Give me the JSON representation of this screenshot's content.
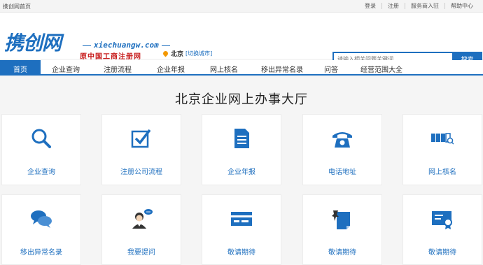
{
  "topbar": {
    "home_link": "携创网首页",
    "links": [
      "登录",
      "注册",
      "服务商入驻",
      "帮助中心"
    ]
  },
  "header": {
    "logo_text": "携创网",
    "logo_url": "xiechuangw.com",
    "slogan": "原中国工商注册网",
    "location": {
      "city": "北京",
      "switch_label": "[切换城市]"
    },
    "search": {
      "placeholder": "请输入相关问题关键词",
      "button_label": "搜索"
    }
  },
  "nav": {
    "items": [
      "首页",
      "企业查询",
      "注册流程",
      "企业年报",
      "网上核名",
      "移出异常名录",
      "问答",
      "经营范围大全"
    ]
  },
  "main": {
    "title": "北京企业网上办事大厅",
    "tiles": [
      {
        "label": "企业查询",
        "icon": "search-icon"
      },
      {
        "label": "注册公司流程",
        "icon": "checkbox-icon"
      },
      {
        "label": "企业年报",
        "icon": "document-icon"
      },
      {
        "label": "电话地址",
        "icon": "telephone-icon"
      },
      {
        "label": "网上核名",
        "icon": "name-check-icon"
      },
      {
        "label": "移出异常名录",
        "icon": "chat-bubbles-icon"
      },
      {
        "label": "我要提问",
        "icon": "question-person-icon"
      },
      {
        "label": "敬请期待",
        "icon": "card-icon"
      },
      {
        "label": "敬请期待",
        "icon": "pin-note-icon"
      },
      {
        "label": "敬请期待",
        "icon": "certificate-icon"
      }
    ]
  },
  "colors": {
    "brand": "#1e6fbf",
    "slogan_red": "#c81e1e",
    "pin_orange": "#f39800"
  }
}
